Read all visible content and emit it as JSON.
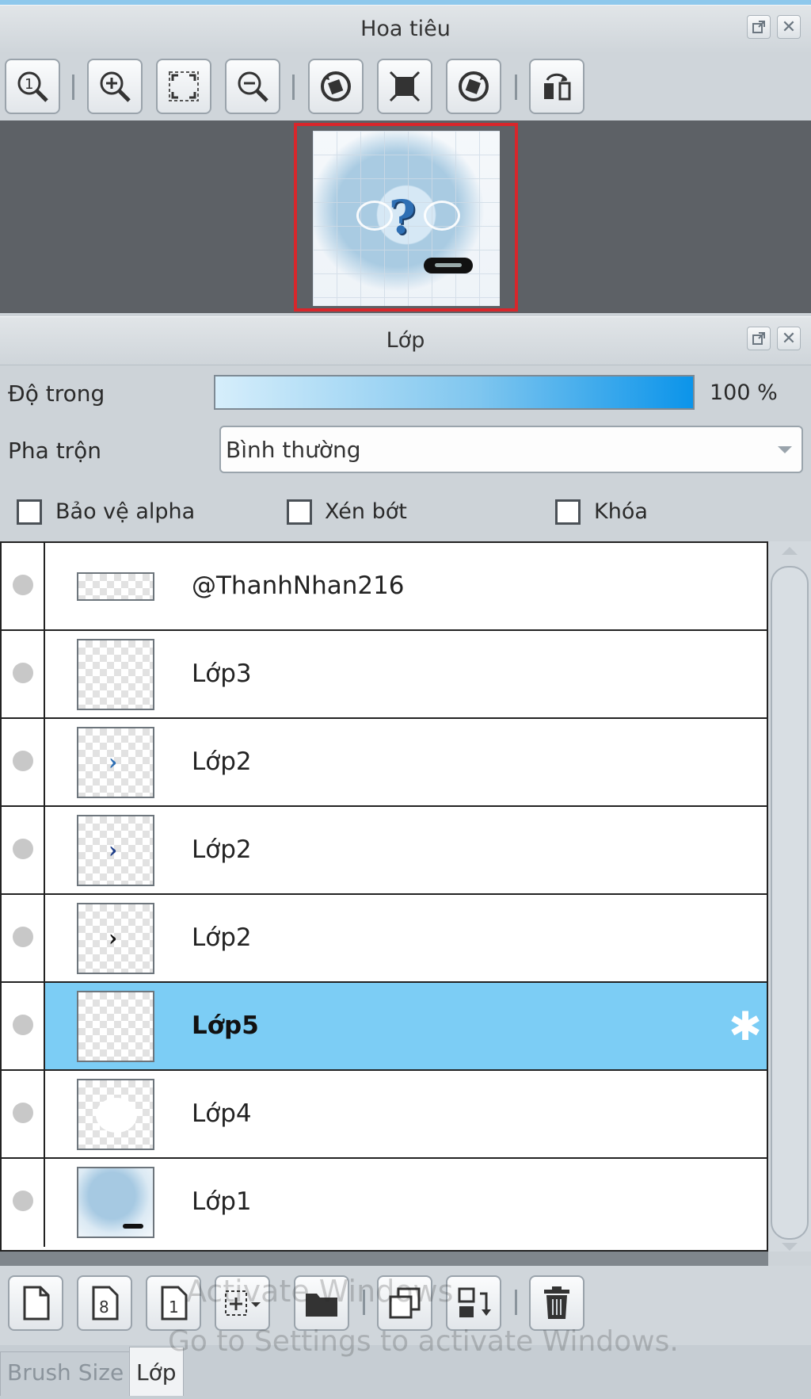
{
  "navigator": {
    "title": "Hoa tiêu",
    "toolbar": [
      {
        "icon": "zoom-actual-size-icon"
      },
      {
        "icon": "zoom-in-icon"
      },
      {
        "icon": "fit-to-window-icon"
      },
      {
        "icon": "zoom-out-icon"
      },
      {
        "icon": "rotate-left-icon"
      },
      {
        "icon": "reset-rotation-icon"
      },
      {
        "icon": "rotate-right-icon"
      },
      {
        "icon": "flip-horizontal-icon"
      }
    ]
  },
  "layers_panel": {
    "title": "Lớp",
    "opacity_label": "Độ trong",
    "opacity_value": "100 %",
    "opacity_fraction": 1.0,
    "blend_label": "Pha trộn",
    "blend_value": "Bình thường",
    "checkboxes": {
      "protect_alpha": "Bảo vệ alpha",
      "clipping": "Xén bớt",
      "lock": "Khóa"
    },
    "layers": [
      {
        "name": "@ThanhNhan216",
        "selected": false
      },
      {
        "name": "Lớp3",
        "selected": false
      },
      {
        "name": "Lớp2",
        "selected": false
      },
      {
        "name": "Lớp2",
        "selected": false
      },
      {
        "name": "Lớp2",
        "selected": false
      },
      {
        "name": "Lớp5",
        "selected": true
      },
      {
        "name": "Lớp4",
        "selected": false
      },
      {
        "name": "Lớp1",
        "selected": false
      }
    ],
    "bottom_toolbar": [
      {
        "icon": "new-layer-icon"
      },
      {
        "icon": "new-8bit-layer-icon"
      },
      {
        "icon": "new-1bit-layer-icon"
      },
      {
        "icon": "add-layer-dropdown-icon"
      },
      {
        "icon": "new-folder-icon"
      },
      {
        "icon": "duplicate-layer-icon"
      },
      {
        "icon": "merge-down-icon"
      },
      {
        "icon": "delete-layer-icon"
      }
    ]
  },
  "tabs": {
    "brush_size": "Brush Size",
    "layer": "Lớp"
  },
  "watermark": {
    "line1": "Activate Windows",
    "line2": "Go to Settings to activate Windows."
  },
  "colors": {
    "selected_row": "#7ccdf5",
    "opacity_bar_end": "#0b94ea",
    "preview_frame": "#d8262b"
  }
}
